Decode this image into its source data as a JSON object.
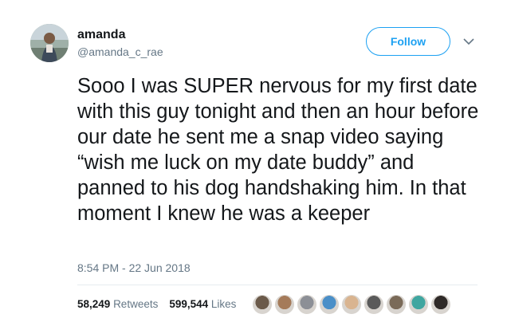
{
  "author": {
    "display_name": "amanda",
    "handle": "@amanda_c_rae"
  },
  "actions": {
    "follow_label": "Follow"
  },
  "tweet": {
    "text": "Sooo I was SUPER nervous for my first date with this guy tonight and then an hour before our date he sent me a snap video saying “wish me luck on my date buddy” and panned to his dog handshaking him. In that moment I knew he was a keeper",
    "timestamp": "8:54 PM - 22 Jun 2018"
  },
  "stats": {
    "retweets_count": "58,249",
    "retweets_label": "Retweets",
    "likes_count": "599,544",
    "likes_label": "Likes"
  },
  "liker_avatar_colors": [
    "#6b5a4a",
    "#a57b5a",
    "#8c8f96",
    "#4a8fc8",
    "#d9b490",
    "#5a5a5a",
    "#7a6a58",
    "#3fa6a0",
    "#2f2a28"
  ],
  "colors": {
    "accent": "#1da1f2",
    "text": "#14171a",
    "secondary": "#657786"
  }
}
